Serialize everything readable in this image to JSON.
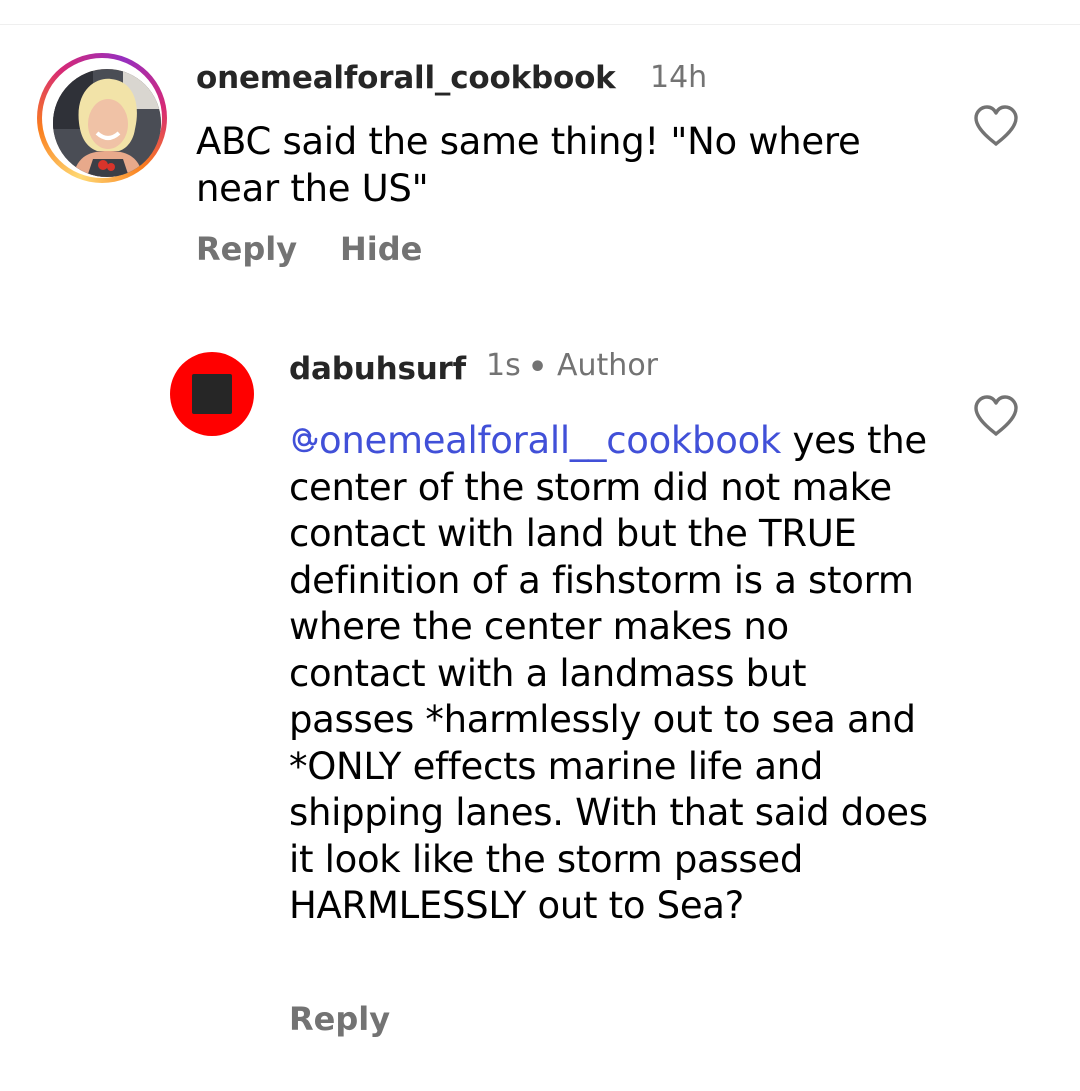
{
  "comments": [
    {
      "username": "onemealforall_cookbook",
      "time": "14h",
      "text": "ABC said the same thing! \"No where near the US\"",
      "actions": {
        "reply": "Reply",
        "hide": "Hide"
      },
      "avatar": "profile-photo-with-story-ring"
    },
    {
      "username": "dabuhsurf",
      "time": "1s",
      "separator": "•",
      "badge": "Author",
      "mention": "onemealforall__cookbook",
      "text": " yes the center of the storm did not make contact with land but the TRUE definition of a fishstorm is a storm where the center makes no contact with a landmass but passes *harmlessly out to sea and *ONLY effects marine life and shipping lanes. With that said does it look like the storm passed HARMLESSLY out to Sea?",
      "actions": {
        "reply": "Reply"
      },
      "avatar": "red-circle-black-square"
    }
  ],
  "icons": {
    "like": "heart-outline-icon",
    "mention": "threads-at-icon"
  },
  "colors": {
    "mention": "#4150d8",
    "secondary_text": "#737373",
    "avatar_red": "#ff0000"
  }
}
